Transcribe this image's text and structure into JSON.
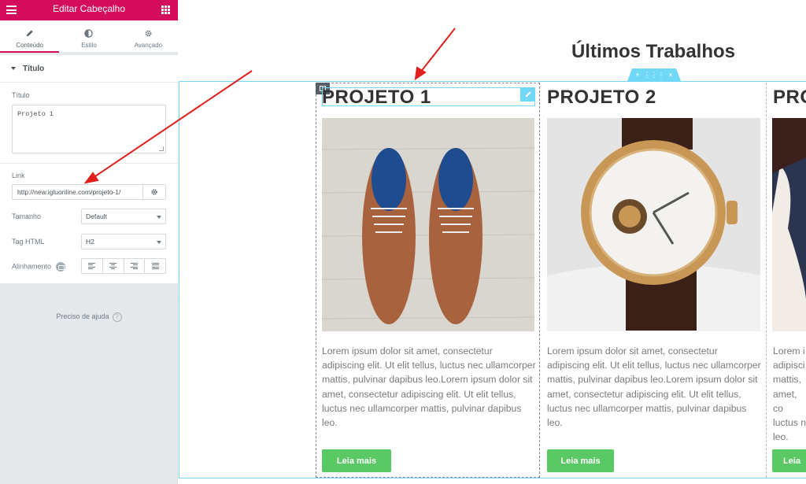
{
  "sidebar": {
    "title": "Editar Cabeçalho",
    "tabs": [
      {
        "label": "Conteúdo",
        "icon": "pencil-icon"
      },
      {
        "label": "Estilo",
        "icon": "half-circle-icon"
      },
      {
        "label": "Avançado",
        "icon": "gear-icon"
      }
    ],
    "section_title": "Título",
    "title_label": "Título",
    "title_value": "Projeto 1",
    "link_label": "Link",
    "link_value": "http://new.igluonline.com/projeto-1/",
    "size_label": "Tamanho",
    "size_value": "Default",
    "tag_label": "Tag HTML",
    "tag_value": "H2",
    "align_label": "Alinhamento",
    "help_text": "Preciso de ajuda",
    "help_icon": "?"
  },
  "canvas": {
    "section_title": "Últimos Trabalhos",
    "handle": {
      "add": "+",
      "move": "⋮⋮⋮",
      "close": "×"
    },
    "cards": [
      {
        "title": "PROJETO 1",
        "text": "Lorem ipsum dolor sit amet, consectetur adipiscing elit. Ut elit tellus, luctus nec ullamcorper mattis, pulvinar dapibus leo.Lorem ipsum dolor sit amet, consectetur adipiscing elit. Ut elit tellus, luctus nec ullamcorper mattis, pulvinar dapibus leo.",
        "button": "Leia mais"
      },
      {
        "title": "PROJETO 2",
        "text": "Lorem ipsum dolor sit amet, consectetur adipiscing elit. Ut elit tellus, luctus nec ullamcorper mattis, pulvinar dapibus leo.Lorem ipsum dolor sit amet, consectetur adipiscing elit. Ut elit tellus, luctus nec ullamcorper mattis, pulvinar dapibus leo.",
        "button": "Leia mais"
      },
      {
        "title": "PRO",
        "text": "Lorem i adipisci mattis, amet, co luctus n leo.",
        "button": "Leia"
      }
    ]
  },
  "colors": {
    "brand": "#d30c5c",
    "edit_accent": "#71d7f7",
    "button": "#5bc866",
    "annotation_arrow": "#e0201c"
  }
}
